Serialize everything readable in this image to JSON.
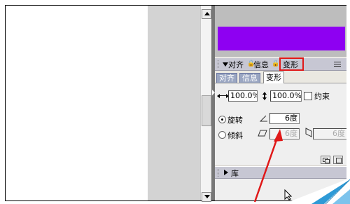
{
  "colors": {
    "fill_swatch": "#8e00f2",
    "highlight_box": "#e01818",
    "annotation_arrow": "#e01818"
  },
  "panel": {
    "header_tabs": [
      "对齐",
      "信息",
      "变形"
    ],
    "separator_icon": "lock-icon",
    "menu_icon": "panel-menu-icon",
    "tabs": [
      "对齐",
      "信息",
      "变形"
    ],
    "active_tab": "变形"
  },
  "transform": {
    "scale_width": "100.0%",
    "scale_height": "100.0%",
    "constrain_label": "约束",
    "constrain_checked": false,
    "rotate_label": "旋转",
    "rotate_value": "6度",
    "rotate_selected": true,
    "skew_label": "倾斜",
    "skew_h_value": "6度",
    "skew_v_value": "6度"
  },
  "library": {
    "label": "库"
  }
}
